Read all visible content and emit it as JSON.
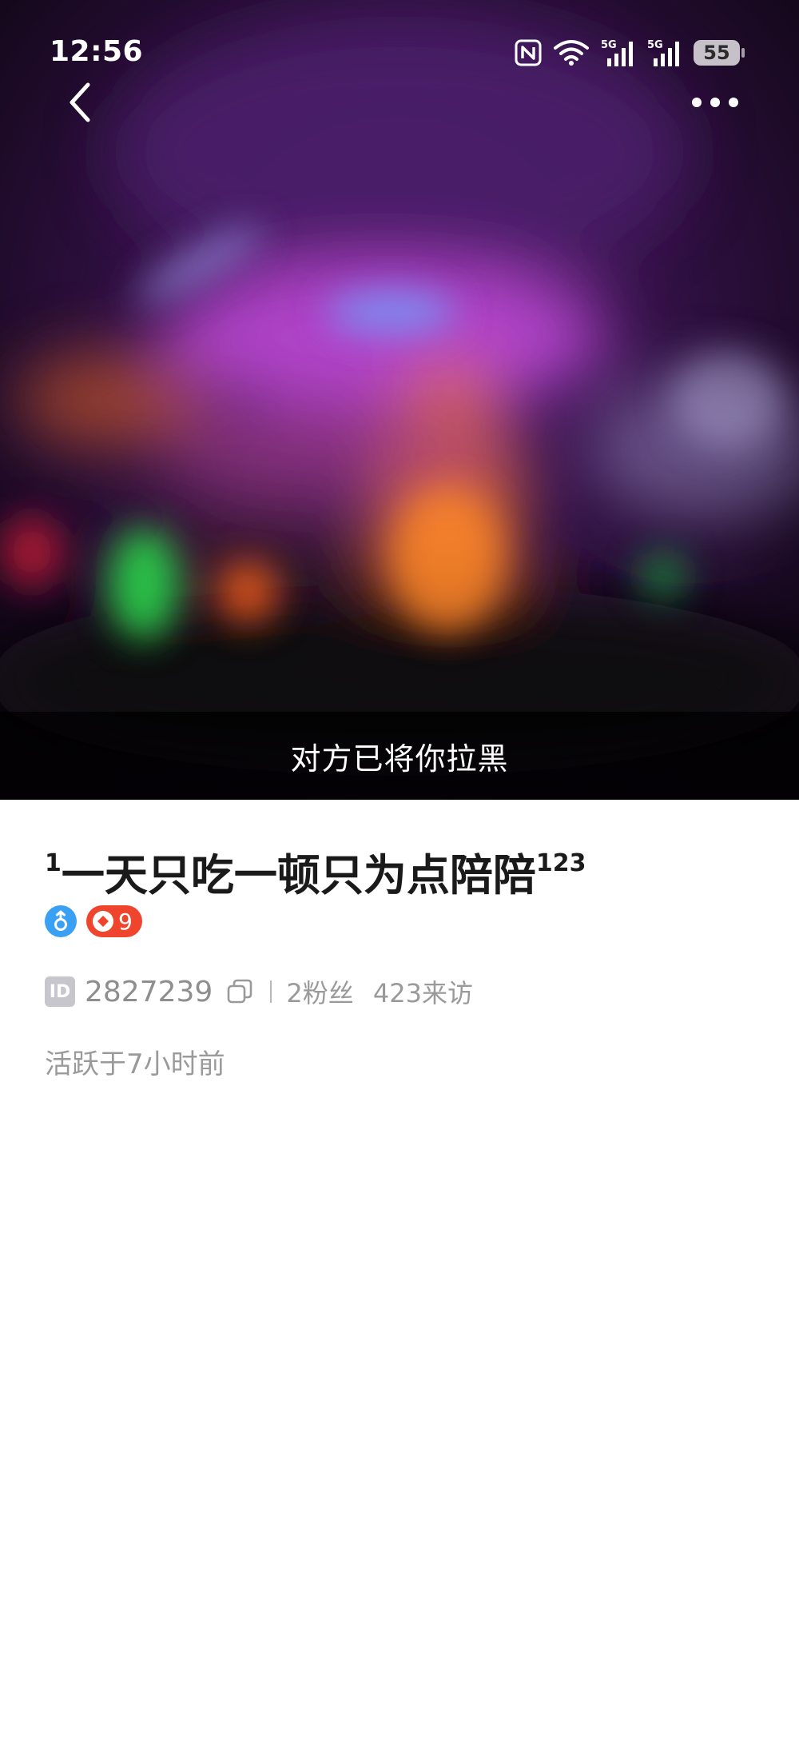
{
  "status_bar": {
    "time": "12:56",
    "icons": [
      "nfc-icon",
      "wifi-icon",
      "signal-5g-icon",
      "signal-5g-icon"
    ],
    "battery": "55"
  },
  "nav": {
    "back_icon": "chevron-left-icon",
    "more_icon": "more-horizontal-icon"
  },
  "hero": {
    "blocked_text": "对方已将你拉黑"
  },
  "profile": {
    "name_prefix": "1",
    "name": "一天只吃一顿只为点陪陪",
    "name_suffix": "123",
    "gender_icon": "male-icon",
    "level": "9",
    "id_label": "ID",
    "user_id": "2827239",
    "fans": "2粉丝",
    "visits": "423来访",
    "active": "活跃于7小时前"
  },
  "colors": {
    "gender_badge": "#3aa0f3",
    "level_badge": "#f0452d",
    "secondary_text": "#9a9a9a",
    "banner_bg": "rgba(0,0,0,0.72)"
  }
}
